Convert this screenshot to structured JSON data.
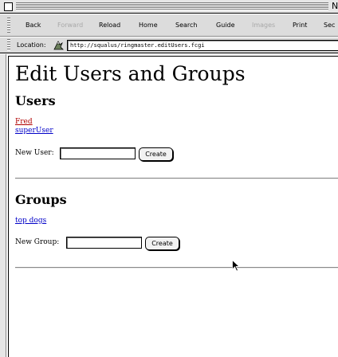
{
  "window": {
    "title_fragment": "N"
  },
  "toolbar": {
    "buttons": [
      {
        "label": "Back",
        "enabled": true
      },
      {
        "label": "Forward",
        "enabled": false
      },
      {
        "label": "Reload",
        "enabled": true
      },
      {
        "label": "Home",
        "enabled": true
      },
      {
        "label": "Search",
        "enabled": true
      },
      {
        "label": "Guide",
        "enabled": true
      },
      {
        "label": "Images",
        "enabled": false
      },
      {
        "label": "Print",
        "enabled": true
      },
      {
        "label": "Sec",
        "enabled": true
      }
    ]
  },
  "location": {
    "label": "Location:",
    "url": "http://squalus/ringmaster.editUsers.fcgi"
  },
  "page": {
    "title": "Edit Users and Groups",
    "users": {
      "heading": "Users",
      "items": [
        {
          "label": "Fred",
          "visited": true
        },
        {
          "label": "superUser",
          "visited": false
        }
      ],
      "new_label": "New User:",
      "input_value": "",
      "button_label": "Create"
    },
    "groups": {
      "heading": "Groups",
      "items": [
        {
          "label": "top dogs",
          "visited": false
        }
      ],
      "new_label": "New Group:",
      "input_value": "",
      "button_label": "Create"
    }
  },
  "colors": {
    "visited_link": "#b00000",
    "link": "#0000c8",
    "chrome": "#dcdcdc"
  }
}
